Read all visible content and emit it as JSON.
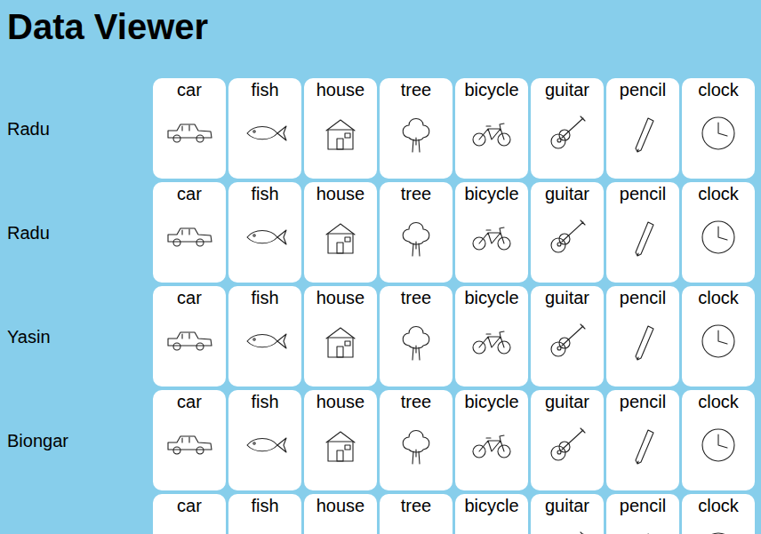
{
  "title": "Data Viewer",
  "rows": [
    {
      "name": "Radu",
      "cards": [
        "car",
        "fish",
        "house",
        "tree",
        "bicycle",
        "guitar",
        "pencil",
        "clock"
      ]
    },
    {
      "name": "Radu",
      "cards": [
        "car",
        "fish",
        "house",
        "tree",
        "bicycle",
        "guitar",
        "pencil",
        "clock"
      ]
    },
    {
      "name": "Yasin",
      "cards": [
        "car",
        "fish",
        "house",
        "tree",
        "bicycle",
        "guitar",
        "pencil",
        "clock"
      ]
    },
    {
      "name": "Biongar",
      "cards": [
        "car",
        "fish",
        "house",
        "tree",
        "bicycle",
        "guitar",
        "pencil",
        "clock"
      ]
    },
    {
      "cards": [
        "car",
        "fish",
        "house",
        "tree",
        "bicycle",
        "guitar",
        "pencil",
        "clock"
      ]
    }
  ]
}
